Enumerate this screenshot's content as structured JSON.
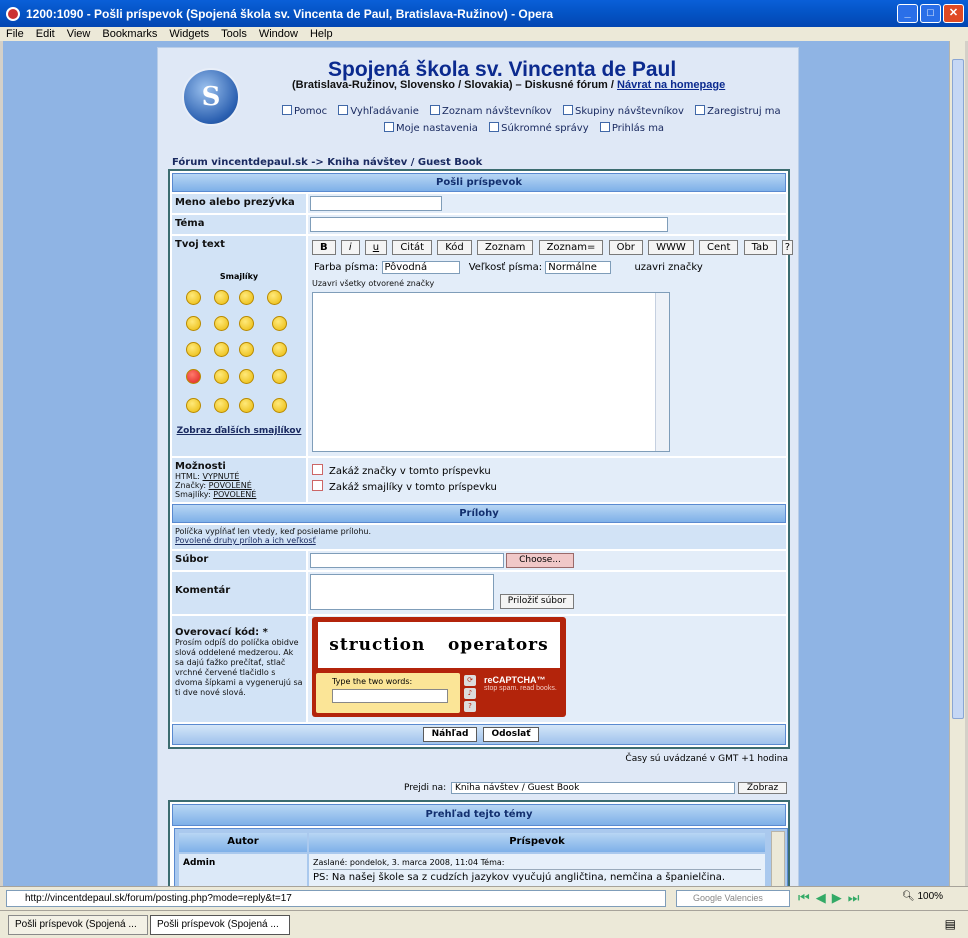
{
  "window": {
    "title": "1200:1090 - Pošli príspevok (Spojená škola sv. Vincenta de Paul, Bratislava-Ružinov) - Opera"
  },
  "menu": [
    "File",
    "Edit",
    "View",
    "Bookmarks",
    "Widgets",
    "Tools",
    "Window",
    "Help"
  ],
  "site": {
    "title": "Spojená škola sv. Vincenta de Paul",
    "subtitle": "(Bratislava-Ružinov, Slovensko / Slovakia) – Diskusné fórum /",
    "homepage_link": "Návrat na homepage",
    "nav_row1": [
      "Pomoc",
      "Vyhľadávanie",
      "Zoznam návštevníkov",
      "Skupiny návštevníkov",
      "Zaregistruj ma"
    ],
    "nav_row2": [
      "Moje nastavenia",
      "Súkromné správy",
      "Prihlás ma"
    ],
    "breadcrumb": "Fórum vincentdepaul.sk -> Kniha návštev / Guest Book"
  },
  "form": {
    "header": "Pošli príspevok",
    "name_label": "Meno alebo prezývka",
    "topic_label": "Téma",
    "text_label": "Tvoj text",
    "smileys_title": "Smajlíky",
    "more_smileys": "Zobraz ďalších smajlíkov",
    "format_buttons": [
      "B",
      "i",
      "u",
      "Citát",
      "Kód",
      "Zoznam",
      "Zoznam=",
      "Obr",
      "WWW",
      "Cent",
      "Tab",
      "?"
    ],
    "color_label": "Farba písma:",
    "color_value": "Pôvodná",
    "size_label": "Veľkosť písma:",
    "size_value": "Normálne",
    "close_tags": "uzavri značky",
    "close_all_tags": "Uzavri všetky otvorené značky",
    "options_label": "Možnosti",
    "html_label": "HTML:",
    "html_value": "VYPNUTÉ",
    "bbcode_label": "Značky:",
    "bbcode_value": "POVOLENÉ",
    "smilies_label": "Smajlíky:",
    "smilies_value": "POVOLENÉ",
    "opt_disable_bbcode": "Zakáž značky v tomto príspevku",
    "opt_disable_smilies": "Zakáž smajlíky v tomto príspevku",
    "attach_header": "Prílohy",
    "attach_note": "Políčka vypĺňať len vtedy, keď posielame prílohu.",
    "attach_link": "Povolené druhy príloh a ich veľkosť",
    "file_label": "Súbor",
    "choose_button": "Choose...",
    "comment_label": "Komentár",
    "attach_button": "Priložiť súbor",
    "captcha_label": "Overovací kód: *",
    "captcha_help": "Prosím odpíš do políčka obidve slová oddelené medzerou. Ak sa dajú ťažko prečítať, stlač vrchné červené tlačidlo s dvoma šípkami a vygenerujú sa ti dve nové slová.",
    "captcha_word1": "struction",
    "captcha_word2": "operators",
    "captcha_prompt": "Type the two words:",
    "captcha_brand": "reCAPTCHA™",
    "captcha_tagline": "stop spam. read books.",
    "preview_button": "Náhľad",
    "submit_button": "Odoslať"
  },
  "footer": {
    "timezone": "Časy sú uvádzané v GMT +1 hodina",
    "jump_label": "Prejdi na:",
    "jump_value": "Kniha návštev / Guest Book",
    "jump_button": "Zobraz",
    "review_header": "Prehľad tejto témy",
    "col_author": "Autor",
    "col_post": "Príspevok",
    "post_author": "Admin",
    "post_meta": "Zaslané: pondelok, 3. marca 2008, 11:04    Téma:",
    "post_text": "PS: Na našej škole sa z cudzích jazykov vyučujú angličtina, nemčina a španielčina."
  },
  "statusbar": {
    "url": "http://vincentdepaul.sk/forum/posting.php?mode=reply&t=17",
    "search_placeholder": "Google Valencies",
    "zoom": "100%"
  },
  "tabs": [
    "Pošli príspevok (Spojená ...",
    "Pošli príspevok (Spojená ..."
  ],
  "colors": {
    "title_blue": "#0b2a8f",
    "header_blue": "#7eb0e8",
    "background": "#8fb4e4"
  }
}
